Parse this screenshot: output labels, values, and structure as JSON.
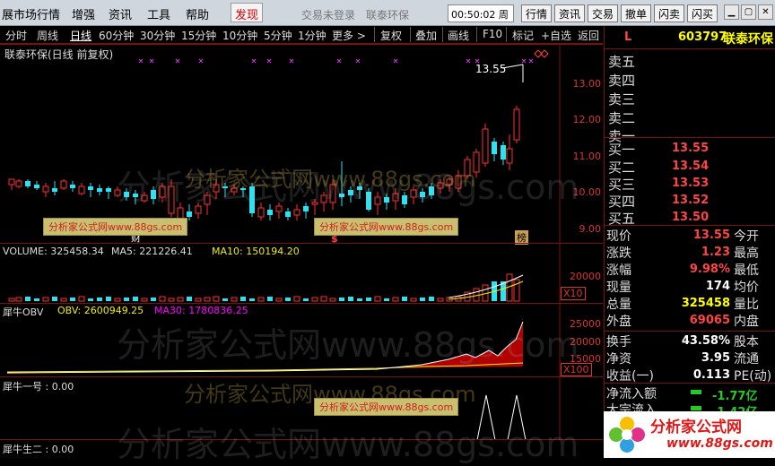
{
  "menu": {
    "items": [
      "展市场行情",
      "增强",
      "资讯",
      "工具",
      "帮助"
    ],
    "active": "发现",
    "status": "交易未登录",
    "stock": "联泰环保",
    "clock": "00:50:02 周一",
    "buttons": [
      "行情",
      "资讯",
      "交易",
      "撤单",
      "闪卖",
      "闪买"
    ]
  },
  "toolbar": {
    "periods": [
      "分时",
      "周线",
      "日线",
      "60分钟",
      "30分钟",
      "15分钟",
      "10分钟",
      "5分钟",
      "1分钟",
      "更多 >"
    ],
    "selected": "日线",
    "actions": [
      "复权",
      "叠加",
      "画线",
      "F10",
      "标记",
      "+自选",
      "返回"
    ]
  },
  "chart": {
    "title": "联泰环保(日线 前复权)",
    "last_label": "13.55",
    "marks": [
      "财",
      "$",
      "榜"
    ],
    "y_ticks": [
      "13.00",
      "12.00",
      "11.00",
      "10.00",
      "9.00"
    ]
  },
  "volume": {
    "label": "VOLUME: 325458.34",
    "ma5": "MA5: 221226.41",
    "ma10": "MA10: 150194.20",
    "ticks": [
      "20000",
      "10000"
    ],
    "unit": "X10"
  },
  "obv": {
    "label": "犀牛OBV",
    "obv": "OBV: 2600949.25",
    "ma30": "MA30: 1780836.25",
    "ticks": [
      "25000",
      "20000",
      "15000",
      "10000",
      "5000"
    ],
    "unit": "X100"
  },
  "ind1": {
    "label": "犀牛一号 : 0.00"
  },
  "ind2": {
    "label": "犀牛生二 : 0.00"
  },
  "quote": {
    "flag": "L",
    "code": "603797",
    "name": "联泰环保",
    "asks": [
      {
        "label": "卖五",
        "price": ""
      },
      {
        "label": "卖四",
        "price": ""
      },
      {
        "label": "卖三",
        "price": ""
      },
      {
        "label": "卖二",
        "price": ""
      },
      {
        "label": "卖一",
        "price": ""
      }
    ],
    "bids": [
      {
        "label": "买一",
        "price": "13.55"
      },
      {
        "label": "买二",
        "price": "13.54"
      },
      {
        "label": "买三",
        "price": "13.53"
      },
      {
        "label": "买四",
        "price": "13.52"
      },
      {
        "label": "买五",
        "price": "13.50"
      }
    ],
    "stats": [
      {
        "l1": "现价",
        "v1": "13.55",
        "c1": "#f44",
        "l2": "今开"
      },
      {
        "l1": "涨跌",
        "v1": "1.23",
        "c1": "#f44",
        "l2": "最高"
      },
      {
        "l1": "涨幅",
        "v1": "9.98%",
        "c1": "#f44",
        "l2": "最低"
      },
      {
        "l1": "现量",
        "v1": "174",
        "c1": "#fff",
        "l2": "均价"
      },
      {
        "l1": "总量",
        "v1": "325458",
        "c1": "#ff0",
        "l2": "量比"
      },
      {
        "l1": "外盘",
        "v1": "69065",
        "c1": "#f44",
        "l2": "内盘"
      }
    ],
    "stats2": [
      {
        "l1": "换手",
        "v1": "43.58%",
        "l2": "股本"
      },
      {
        "l1": "净资",
        "v1": "3.95",
        "l2": "流通"
      },
      {
        "l1": "收益(一)",
        "v1": "0.113",
        "l2": "PE(动)"
      }
    ],
    "flow": [
      {
        "label": "净流入额",
        "value": "-1.77亿"
      },
      {
        "label": "大宗流入",
        "value": "-1.42亿"
      }
    ]
  },
  "watermark": {
    "big": "分析家公式网www.88gs.com",
    "small": "分析家公式网www.88gs.com",
    "logo_main": "分析家公式网",
    "logo_url": "www.88gs.com"
  }
}
